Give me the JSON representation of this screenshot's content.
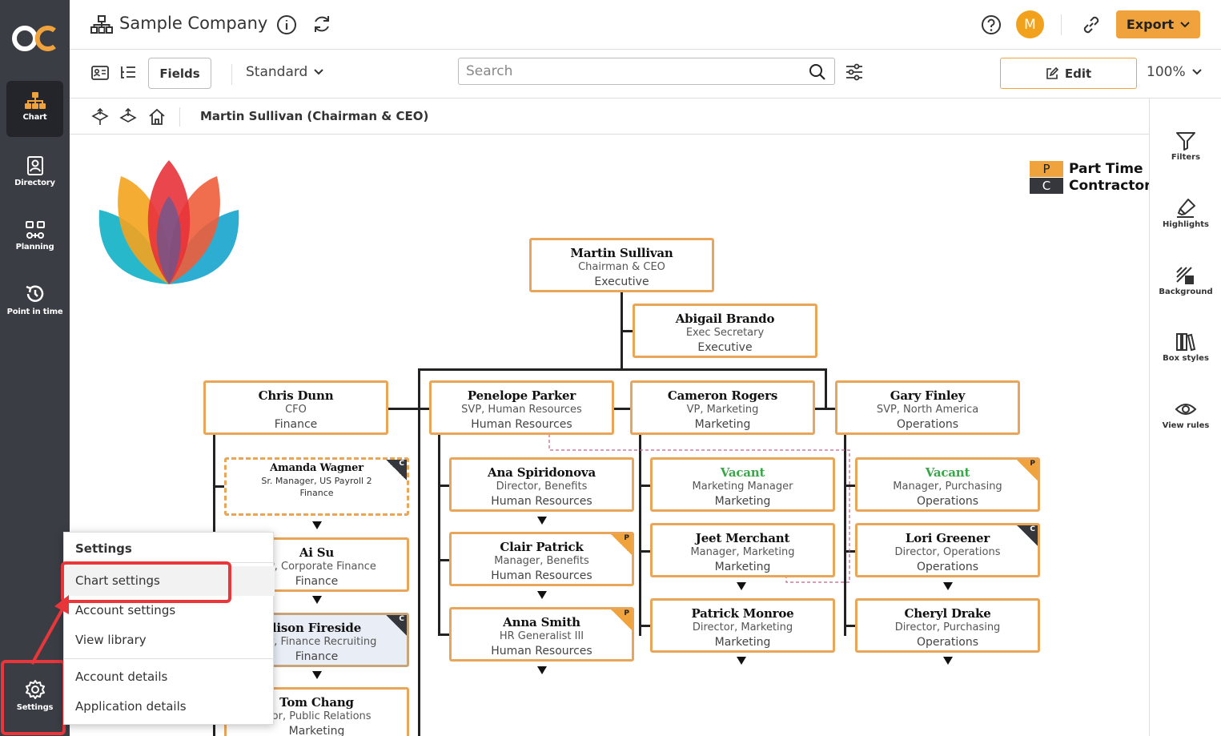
{
  "app": {
    "company_name": "Sample Company",
    "logo_text": "OC",
    "avatar_initial": "M",
    "export_label": "Export"
  },
  "nav": {
    "chart": "Chart",
    "directory": "Directory",
    "planning": "Planning",
    "point_in_time": "Point in time",
    "settings": "Settings"
  },
  "toolbar": {
    "fields_label": "Fields",
    "view_mode": "Standard",
    "search_placeholder": "Search",
    "edit_label": "Edit",
    "zoom": "100%"
  },
  "breadcrumb": "Martin Sullivan (Chairman & CEO)",
  "right_panel": {
    "filters": "Filters",
    "highlights": "Highlights",
    "background": "Background",
    "box_styles": "Box styles",
    "view_rules": "View rules"
  },
  "legend": [
    {
      "code": "P",
      "label": "Part Time",
      "color": "#f0a23c"
    },
    {
      "code": "C",
      "label": "Contractor",
      "color": "#35373d"
    }
  ],
  "org": {
    "ceo": {
      "name": "Martin Sullivan",
      "role": "Chairman & CEO",
      "dept": "Executive"
    },
    "assistant": {
      "name": "Abigail Brando",
      "role": "Exec Secretary",
      "dept": "Executive"
    },
    "chris": {
      "name": "Chris  Dunn",
      "role": "CFO",
      "dept": "Finance"
    },
    "penelope": {
      "name": "Penelope Parker",
      "role": "SVP, Human Resources",
      "dept": "Human Resources"
    },
    "cameron": {
      "name": "Cameron Rogers",
      "role": "VP, Marketing",
      "dept": "Marketing"
    },
    "gary": {
      "name": "Gary Finley",
      "role": "SVP, North America",
      "dept": "Operations"
    },
    "amanda": {
      "name": "Amanda Wagner",
      "role": "Sr. Manager, US Payroll 2",
      "dept": "Finance",
      "tag": "C"
    },
    "aisu": {
      "name": "Ai Su",
      "role": "ger, Corporate Finance",
      "dept": "Finance"
    },
    "alison": {
      "name": "lison Fireside",
      "role": "ger, Finance Recruiting",
      "dept": "Finance",
      "tag": "C"
    },
    "tom": {
      "name": "Tom Chang",
      "role": "ctor, Public Relations",
      "dept": "Marketing"
    },
    "ana": {
      "name": "Ana Spiridonova",
      "role": "Director, Benefits",
      "dept": "Human Resources"
    },
    "clair": {
      "name": "Clair Patrick",
      "role": "Manager, Benefits",
      "dept": "Human Resources",
      "tag": "P"
    },
    "anna": {
      "name": "Anna Smith",
      "role": "HR Generalist III",
      "dept": "Human Resources",
      "tag": "P"
    },
    "vacant_mkt": {
      "name": "Vacant",
      "role": "Marketing Manager",
      "dept": "Marketing"
    },
    "jeet": {
      "name": "Jeet Merchant",
      "role": "Manager, Marketing",
      "dept": "Marketing"
    },
    "patrick": {
      "name": "Patrick Monroe",
      "role": "Director, Marketing",
      "dept": "Marketing"
    },
    "vacant_ops": {
      "name": "Vacant",
      "role": "Manager, Purchasing",
      "dept": "Operations",
      "tag": "P"
    },
    "lori": {
      "name": "Lori Greener",
      "role": "Director, Operations",
      "dept": "Operations",
      "tag": "C"
    },
    "cheryl": {
      "name": "Cheryl Drake",
      "role": "Director, Purchasing",
      "dept": "Operations"
    }
  },
  "settings_menu": {
    "header": "Settings",
    "items": [
      "Chart settings",
      "Account settings",
      "View library",
      "Account details",
      "Application details"
    ]
  }
}
